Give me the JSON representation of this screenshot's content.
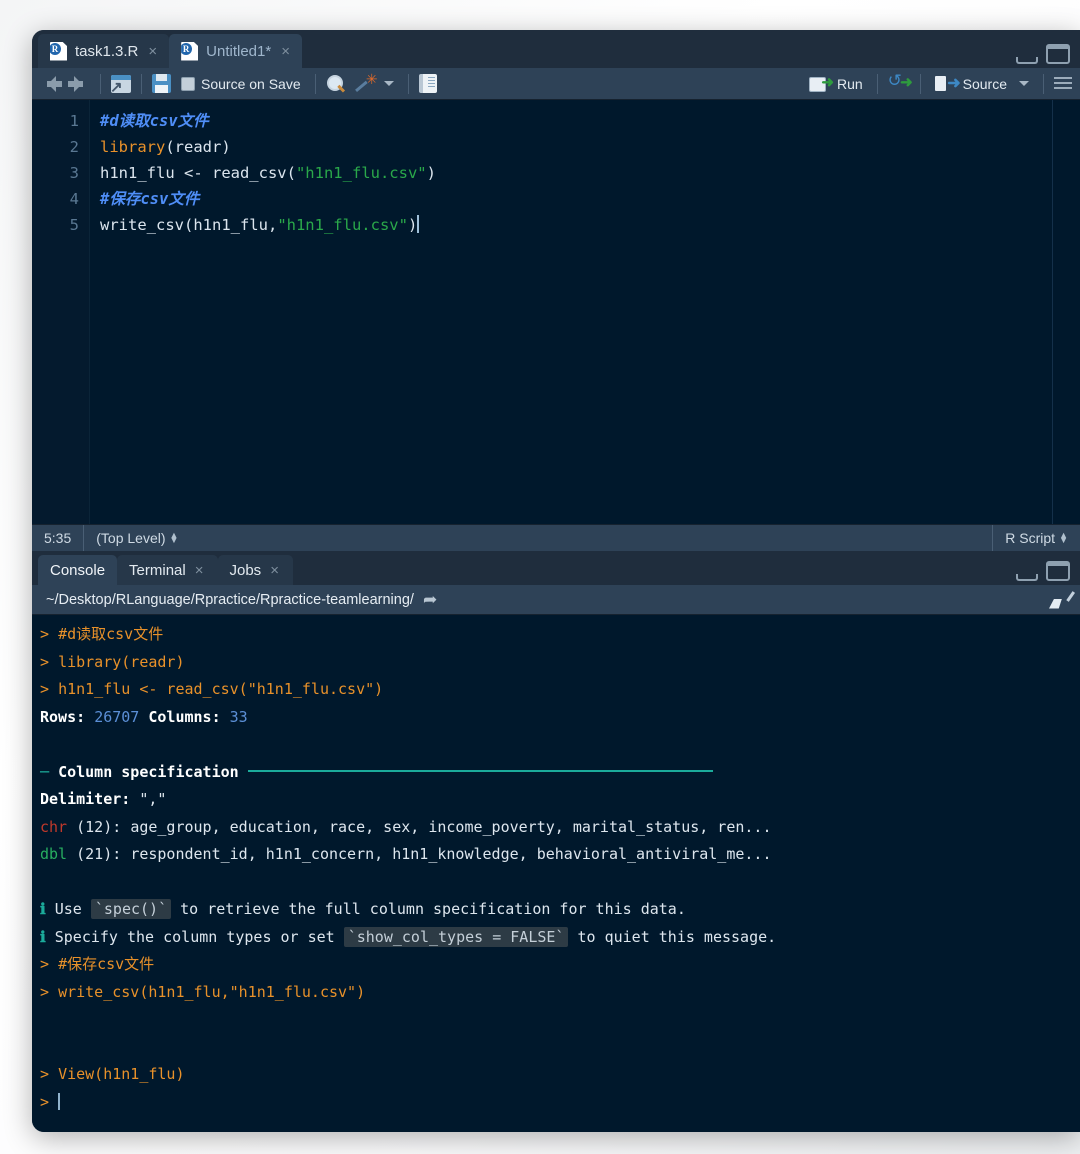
{
  "source": {
    "tabs": [
      {
        "label": "task1.3.R",
        "active": false,
        "close": "×",
        "icon": "r-file-icon"
      },
      {
        "label": "Untitled1*",
        "active": true,
        "close": "×",
        "icon": "r-file-icon"
      }
    ],
    "window_buttons": {
      "minimize": "minimize-icon",
      "maximize": "maximize-icon"
    },
    "toolbar": {
      "back": "back-arrow-icon",
      "forward": "forward-arrow-icon",
      "popout": "show-in-new-window-icon",
      "save": "save-icon",
      "source_on_save_label": "Source on Save",
      "find": "find-icon",
      "code_tools": "magic-wand-icon",
      "code_tools_caret": "chevron-down-icon",
      "compile_report": "notebook-icon",
      "run_label": "Run",
      "rerun": "rerun-icon",
      "source_label": "Source",
      "source_caret": "chevron-down-icon",
      "outline": "document-outline-icon"
    },
    "lines": [
      {
        "n": "1",
        "tokens": [
          {
            "t": "comment",
            "v": "#d读取csv文件"
          }
        ]
      },
      {
        "n": "2",
        "tokens": [
          {
            "t": "fn",
            "v": "library"
          },
          {
            "t": "op",
            "v": "(readr)"
          }
        ]
      },
      {
        "n": "3",
        "tokens": [
          {
            "t": "op",
            "v": "h1n1_flu <- read_csv("
          },
          {
            "t": "str",
            "v": "\"h1n1_flu.csv\""
          },
          {
            "t": "op",
            "v": ")"
          }
        ]
      },
      {
        "n": "4",
        "tokens": [
          {
            "t": "comment",
            "v": "#保存csv文件"
          }
        ]
      },
      {
        "n": "5",
        "tokens": [
          {
            "t": "op",
            "v": "write_csv(h1n1_flu,"
          },
          {
            "t": "str",
            "v": "\"h1n1_flu.csv\""
          },
          {
            "t": "op",
            "v": ")"
          }
        ]
      }
    ],
    "status": {
      "position": "5:35",
      "scope": "(Top Level)",
      "scope_stepper": "stepper-icon",
      "doc_type": "R Script",
      "doc_type_stepper": "stepper-icon"
    }
  },
  "console": {
    "tabs": [
      {
        "label": "Console",
        "active": true,
        "close": ""
      },
      {
        "label": "Terminal",
        "active": false,
        "close": "×"
      },
      {
        "label": "Jobs",
        "active": false,
        "close": "×"
      }
    ],
    "window_buttons": {
      "minimize": "minimize-icon",
      "maximize": "maximize-icon"
    },
    "path": "~/Desktop/RLanguage/Rpractice/Rpractice-teamlearning/",
    "path_arrow": "go-to-directory-icon",
    "clear_icon": "broom-icon",
    "output": [
      {
        "type": "cmd",
        "prompt": "> ",
        "text": "#d读取csv文件"
      },
      {
        "type": "cmd",
        "prompt": "> ",
        "text": "library(readr)"
      },
      {
        "type": "cmd",
        "prompt": "> ",
        "text": "h1n1_flu <- read_csv(\"h1n1_flu.csv\")"
      },
      {
        "type": "rowscols",
        "rows_label": "Rows:",
        "rows_value": "26707",
        "cols_label": "Columns:",
        "cols_value": "33"
      },
      {
        "type": "blank"
      },
      {
        "type": "header",
        "dash": "─",
        "title": "Column specification"
      },
      {
        "type": "delimiter",
        "label": "Delimiter:",
        "value": "\",\""
      },
      {
        "type": "coltype",
        "kind": "chr",
        "count": "(12):",
        "cols": "age_group, education, race, sex, income_poverty, marital_status, ren..."
      },
      {
        "type": "coltype",
        "kind": "dbl",
        "count": "(21):",
        "cols": "respondent_id, h1n1_concern, h1n1_knowledge, behavioral_antiviral_me..."
      },
      {
        "type": "blank"
      },
      {
        "type": "info",
        "bullet": "ℹ",
        "pre": "Use ",
        "code": "`spec()`",
        "post": " to retrieve the full column specification for this data."
      },
      {
        "type": "info",
        "bullet": "ℹ",
        "pre": "Specify the column types or set ",
        "code": "`show_col_types = FALSE`",
        "post": " to quiet this message."
      },
      {
        "type": "cmd",
        "prompt": "> ",
        "text": "#保存csv文件"
      },
      {
        "type": "cmd",
        "prompt": "> ",
        "text": "write_csv(h1n1_flu,\"h1n1_flu.csv\")"
      },
      {
        "type": "blank"
      },
      {
        "type": "blank"
      },
      {
        "type": "cmd",
        "prompt": "> ",
        "text": "View(h1n1_flu)"
      },
      {
        "type": "promptonly",
        "prompt": "> "
      }
    ]
  },
  "colors": {
    "editor_bg": "#00182c",
    "panel_bg": "#2e4257",
    "window_bg": "#1f2d3d",
    "comment": "#4f8ef7",
    "function": "#e8912a",
    "string": "#2aa84a",
    "console_cmd": "#e8912a",
    "number": "#5b8fd6",
    "teal": "#1bab9b",
    "chr": "#c0392b",
    "dbl": "#27ae60"
  }
}
